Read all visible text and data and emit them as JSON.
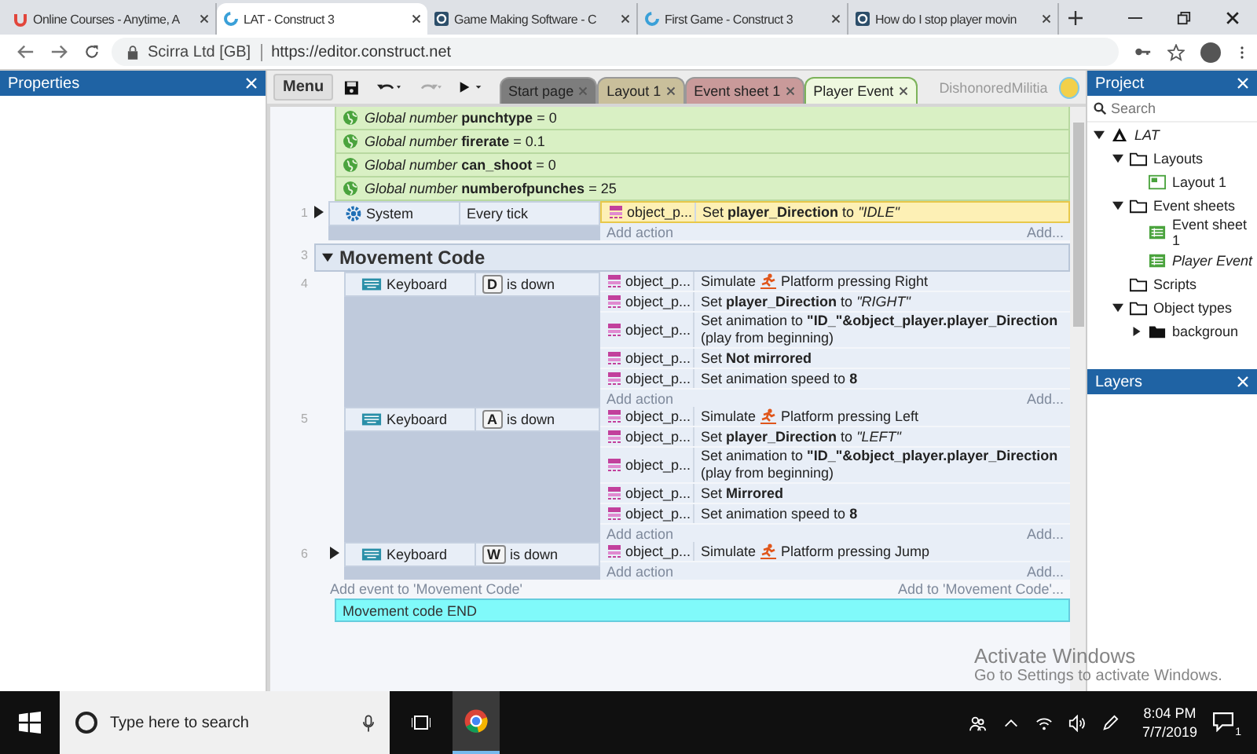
{
  "browser": {
    "tabs": [
      {
        "title": "Online Courses - Anytime, A",
        "selected": false
      },
      {
        "title": "LAT - Construct 3",
        "selected": true
      },
      {
        "title": "Game Making Software - C",
        "selected": false
      },
      {
        "title": "First Game - Construct 3",
        "selected": false
      },
      {
        "title": "How do I stop player movin",
        "selected": false
      }
    ],
    "site": "Scirra Ltd [GB]",
    "url": "https://editor.construct.net"
  },
  "properties_panel": {
    "title": "Properties"
  },
  "toolbar": {
    "menu": "Menu",
    "user": "DishonoredMilitia",
    "tabs": [
      {
        "label": "Start page",
        "color": "#7d7d7d",
        "selected": false
      },
      {
        "label": "Layout 1",
        "color": "#c9bf9b",
        "selected": false
      },
      {
        "label": "Event sheet 1",
        "color": "#c99a9a",
        "selected": false
      },
      {
        "label": "Player Event",
        "color": "#eef8df",
        "selected": true
      }
    ]
  },
  "globals": [
    "*Global number* **punchtype** = 0",
    "*Global number* **firerate** = 0.1",
    "*Global number* **can_shoot** = 0",
    "*Global number* **numberofpunches** = 25"
  ],
  "events": [
    {
      "number": "1",
      "kind": "system",
      "toggle": true,
      "object": "System",
      "condition": "Every tick",
      "actions": [
        {
          "kind": "text",
          "object": "object_p...",
          "text": "Set **player_Direction** to *\"IDLE\"*",
          "selected": true
        }
      ],
      "add_action": "Add action",
      "add_more": "Add..."
    }
  ],
  "group": {
    "number": "3",
    "title": "Movement Code",
    "expanded": true,
    "events": [
      {
        "number": "4",
        "kind": "keyboard",
        "toggle": false,
        "object": "Keyboard",
        "key": "D",
        "condition": "is down",
        "actions": [
          {
            "kind": "simulate",
            "object": "object_p...",
            "verb": "Simulate",
            "text": "Platform pressing Right",
            "selected": false
          },
          {
            "kind": "text",
            "object": "object_p...",
            "text": "Set **player_Direction** to *\"RIGHT\"*",
            "selected": false
          },
          {
            "kind": "text",
            "object": "object_p...",
            "text": "Set animation to **\"ID_\"&object_player.player_Direction** (play from beginning)",
            "selected": false
          },
          {
            "kind": "text",
            "object": "object_p...",
            "text": "Set **Not mirrored**",
            "selected": false
          },
          {
            "kind": "text",
            "object": "object_p...",
            "text": "Set animation speed to **8**",
            "selected": false
          }
        ],
        "add_action": "Add action",
        "add_more": "Add..."
      },
      {
        "number": "5",
        "kind": "keyboard",
        "toggle": false,
        "object": "Keyboard",
        "key": "A",
        "condition": "is down",
        "actions": [
          {
            "kind": "simulate",
            "object": "object_p...",
            "verb": "Simulate",
            "text": "Platform pressing Left",
            "selected": false
          },
          {
            "kind": "text",
            "object": "object_p...",
            "text": "Set **player_Direction** to *\"LEFT\"*",
            "selected": false
          },
          {
            "kind": "text",
            "object": "object_p...",
            "text": "Set animation to **\"ID_\"&object_player.player_Direction** (play from beginning)",
            "selected": false
          },
          {
            "kind": "text",
            "object": "object_p...",
            "text": "Set **Mirrored**",
            "selected": false
          },
          {
            "kind": "text",
            "object": "object_p...",
            "text": "Set animation speed to **8**",
            "selected": false
          }
        ],
        "add_action": "Add action",
        "add_more": "Add..."
      },
      {
        "number": "6",
        "kind": "keyboard",
        "toggle": true,
        "object": "Keyboard",
        "key": "W",
        "condition": "is down",
        "actions": [
          {
            "kind": "simulate",
            "object": "object_p...",
            "verb": "Simulate",
            "text": "Platform pressing Jump",
            "selected": false
          }
        ],
        "add_action": "Add action",
        "add_more": "Add..."
      }
    ],
    "add_event": "Add event to 'Movement Code'",
    "add_to": "Add to 'Movement Code'..."
  },
  "comment": "Movement code END",
  "project_panel": {
    "title": "Project",
    "search_placeholder": "Search",
    "tree": [
      {
        "label": "LAT",
        "kind": "project",
        "expanded": true,
        "emphasized": true,
        "children": [
          {
            "label": "Layouts",
            "kind": "folder",
            "expanded": true,
            "emphasized": false,
            "children": [
              {
                "label": "Layout 1",
                "kind": "layout",
                "emphasized": false
              }
            ]
          },
          {
            "label": "Event sheets",
            "kind": "folder",
            "expanded": true,
            "emphasized": false,
            "children": [
              {
                "label": "Event sheet 1",
                "kind": "eventsheet",
                "emphasized": false
              },
              {
                "label": "Player Event",
                "kind": "eventsheet",
                "emphasized": true
              }
            ]
          },
          {
            "label": "Scripts",
            "kind": "folder",
            "emphasized": false
          },
          {
            "label": "Object types",
            "kind": "folder",
            "expanded": true,
            "emphasized": false,
            "children": [
              {
                "label": "backgroun",
                "kind": "folder-filled",
                "expanded": false,
                "emphasized": false
              }
            ]
          }
        ]
      }
    ]
  },
  "layers_panel": {
    "title": "Layers"
  },
  "taskbar": {
    "search_placeholder": "Type here to search",
    "time": "8:04 PM",
    "date": "7/7/2019",
    "notifications": "1"
  },
  "activation_notice": {
    "title": "Activate Windows",
    "text": "Go to Settings to activate Windows."
  }
}
